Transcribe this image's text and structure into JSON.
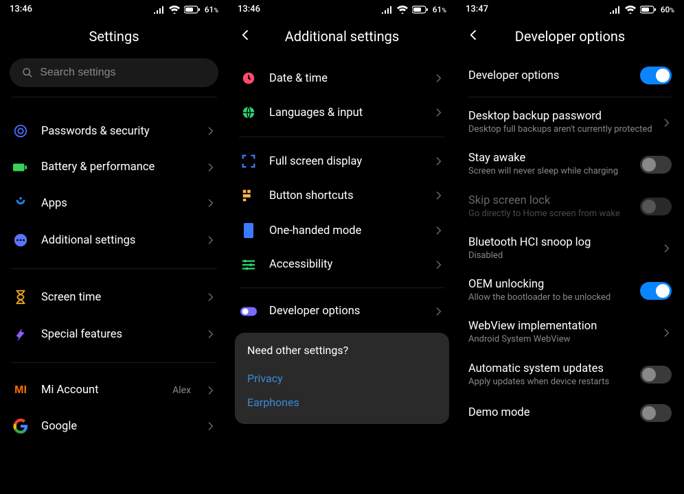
{
  "panel1": {
    "time": "13:46",
    "battery": "61",
    "title": "Settings",
    "search_placeholder": "Search settings",
    "groups": [
      {
        "items": [
          {
            "id": "passwords",
            "label": "Passwords & security",
            "icon_color": "#4a6cff"
          },
          {
            "id": "battery",
            "label": "Battery & performance",
            "icon_color": "#3ad15b"
          },
          {
            "id": "apps",
            "label": "Apps",
            "icon_color": "#1e88ff"
          },
          {
            "id": "additional",
            "label": "Additional settings",
            "icon_color": "#5a74ff"
          }
        ]
      },
      {
        "items": [
          {
            "id": "screen-time",
            "label": "Screen time",
            "icon_color": "#f5a623"
          },
          {
            "id": "special",
            "label": "Special features",
            "icon_color": "#8a5cff"
          }
        ]
      },
      {
        "items": [
          {
            "id": "mi-account",
            "label": "Mi Account",
            "icon_color": "#ff6f00",
            "value": "Alex"
          },
          {
            "id": "google",
            "label": "Google",
            "icon_color": "#ffffff"
          }
        ]
      }
    ]
  },
  "panel2": {
    "time": "13:46",
    "battery": "61",
    "title": "Additional settings",
    "groups": [
      {
        "items": [
          {
            "id": "date-time",
            "label": "Date & time",
            "icon_color": "#ff4b6b"
          },
          {
            "id": "languages",
            "label": "Languages & input",
            "icon_color": "#2ed573"
          }
        ]
      },
      {
        "items": [
          {
            "id": "full-screen",
            "label": "Full screen display",
            "icon_color": "#3a7bff"
          },
          {
            "id": "button-shortcuts",
            "label": "Button shortcuts",
            "icon_color": "#ffb74d"
          },
          {
            "id": "one-handed",
            "label": "One-handed mode",
            "icon_color": "#3a7bff"
          },
          {
            "id": "accessibility",
            "label": "Accessibility",
            "icon_color": "#2ed573"
          }
        ]
      },
      {
        "items": [
          {
            "id": "developer",
            "label": "Developer options",
            "icon_color": "#7a6bff"
          }
        ]
      }
    ],
    "card": {
      "question": "Need other settings?",
      "links": [
        "Privacy",
        "Earphones"
      ]
    }
  },
  "panel3": {
    "time": "13:47",
    "battery": "60",
    "title": "Developer options",
    "items": [
      {
        "id": "dev-main",
        "title": "Developer options",
        "toggle": "on"
      },
      {
        "div": true
      },
      {
        "id": "backup-pwd",
        "title": "Desktop backup password",
        "sub": "Desktop full backups aren't currently protected",
        "chev": true
      },
      {
        "id": "stay-awake",
        "title": "Stay awake",
        "sub": "Screen will never sleep while charging",
        "toggle": "off"
      },
      {
        "id": "skip-lock",
        "title": "Skip screen lock",
        "sub": "Go directly to Home screen from wake",
        "toggle": "off",
        "disabled": true
      },
      {
        "id": "bt-hci",
        "title": "Bluetooth HCI snoop log",
        "sub": "Disabled",
        "chev": true
      },
      {
        "id": "oem",
        "title": "OEM unlocking",
        "sub": "Allow the bootloader to be unlocked",
        "toggle": "on"
      },
      {
        "id": "webview",
        "title": "WebView implementation",
        "sub": "Android System WebView",
        "chev": true
      },
      {
        "id": "auto-updates",
        "title": "Automatic system updates",
        "sub": "Apply updates when device restarts",
        "toggle": "off"
      },
      {
        "id": "demo",
        "title": "Demo mode",
        "toggle": "off"
      }
    ]
  }
}
